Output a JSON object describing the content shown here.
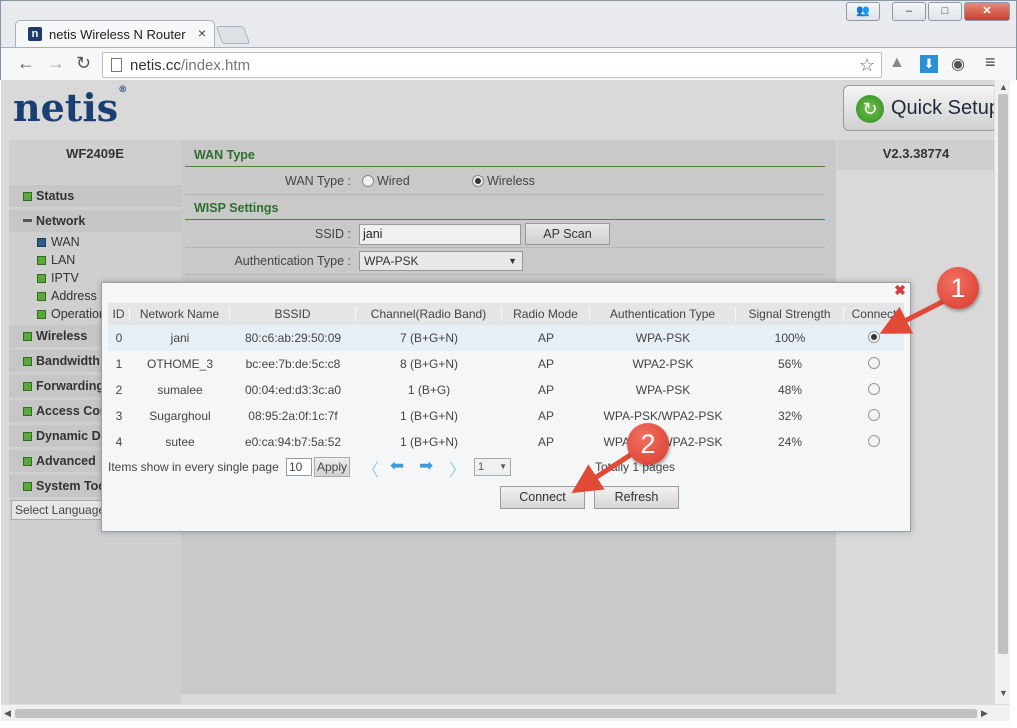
{
  "browser": {
    "tab_title": "netis Wireless N Router",
    "tab_close": "×",
    "url_host": "netis.cc",
    "url_path": "/index.htm",
    "window_buttons": [
      "–",
      "□",
      "✕"
    ]
  },
  "header": {
    "logo": "netis",
    "logo_mark": "®",
    "quick_setup": "Quick Setup",
    "model": "WF2409E",
    "version": "V2.3.38774"
  },
  "sidebar": {
    "status": "Status",
    "network": "Network",
    "network_sub": [
      "WAN",
      "LAN",
      "IPTV",
      "Address Reservation",
      "Operation Mode"
    ],
    "wireless": "Wireless",
    "bandwidth": "Bandwidth Control",
    "forwarding": "Forwarding Rules",
    "access": "Access Control",
    "dynamic": "Dynamic DNS",
    "advanced": "Advanced",
    "system": "System Tools",
    "language": "Select Language"
  },
  "wan": {
    "section_title": "WAN Type",
    "wan_type_label": "WAN Type :",
    "opt_wired": "Wired",
    "opt_wireless": "Wireless",
    "wisp_title": "WISP Settings",
    "ssid_label": "SSID :",
    "ssid_value": "jani",
    "ap_scan": "AP Scan",
    "auth_label": "Authentication Type :",
    "auth_value": "WPA-PSK"
  },
  "scan_dialog": {
    "close": "✖",
    "columns": [
      "ID",
      "Network Name",
      "BSSID",
      "Channel(Radio Band)",
      "Radio Mode",
      "Authentication Type",
      "Signal Strength",
      "Connect"
    ],
    "rows": [
      {
        "id": "0",
        "name": "jani",
        "bssid": "80:c6:ab:29:50:09",
        "channel": "7 (B+G+N)",
        "mode": "AP",
        "auth": "WPA-PSK",
        "signal": "100%"
      },
      {
        "id": "1",
        "name": "OTHOME_3",
        "bssid": "bc:ee:7b:de:5c:c8",
        "channel": "8 (B+G+N)",
        "mode": "AP",
        "auth": "WPA2-PSK",
        "signal": "56%"
      },
      {
        "id": "2",
        "name": "sumalee",
        "bssid": "00:04:ed:d3:3c:a0",
        "channel": "1 (B+G)",
        "mode": "AP",
        "auth": "WPA-PSK",
        "signal": "48%"
      },
      {
        "id": "3",
        "name": "Sugarghoul",
        "bssid": "08:95:2a:0f:1c:7f",
        "channel": "1 (B+G+N)",
        "mode": "AP",
        "auth": "WPA-PSK/WPA2-PSK",
        "signal": "32%"
      },
      {
        "id": "4",
        "name": "sutee",
        "bssid": "e0:ca:94:b7:5a:52",
        "channel": "1 (B+G+N)",
        "mode": "AP",
        "auth": "WPA-PSK/WPA2-PSK",
        "signal": "24%"
      }
    ],
    "selected_row": 0,
    "pager": {
      "items_label": "Items show in every single page",
      "items_value": "10",
      "apply": "Apply",
      "page_value": "1",
      "total": "Totally 1 pages"
    },
    "connect": "Connect",
    "refresh": "Refresh"
  },
  "annotations": [
    "1",
    "2"
  ]
}
